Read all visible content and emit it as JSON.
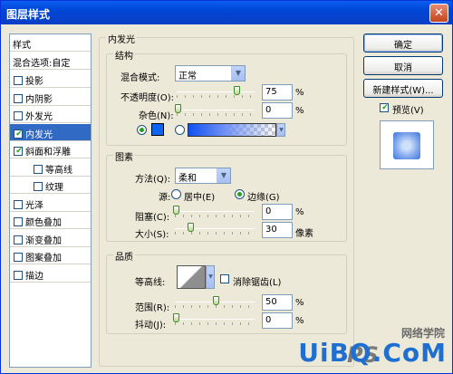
{
  "window": {
    "title": "图层样式"
  },
  "sidebar": {
    "header": "样式",
    "blending": "混合选项:自定",
    "items": [
      {
        "label": "投影",
        "checked": false,
        "selected": false
      },
      {
        "label": "内阴影",
        "checked": false,
        "selected": false
      },
      {
        "label": "外发光",
        "checked": false,
        "selected": false
      },
      {
        "label": "内发光",
        "checked": true,
        "selected": true
      },
      {
        "label": "斜面和浮雕",
        "checked": true,
        "selected": false
      },
      {
        "label": "等高线",
        "checked": false,
        "selected": false,
        "indent": true
      },
      {
        "label": "纹理",
        "checked": false,
        "selected": false,
        "indent": true
      },
      {
        "label": "光泽",
        "checked": false,
        "selected": false
      },
      {
        "label": "颜色叠加",
        "checked": false,
        "selected": false
      },
      {
        "label": "渐变叠加",
        "checked": false,
        "selected": false
      },
      {
        "label": "图案叠加",
        "checked": false,
        "selected": false
      },
      {
        "label": "描边",
        "checked": false,
        "selected": false
      }
    ]
  },
  "panel": {
    "title": "内发光",
    "structure": {
      "label": "结构",
      "blend_mode_label": "混合模式:",
      "blend_mode": "正常",
      "opacity_label": "不透明度(O):",
      "opacity": "75",
      "noise_label": "杂色(N):",
      "noise": "0",
      "unit": "%"
    },
    "elements": {
      "label": "图素",
      "method_label": "方法(Q):",
      "method": "柔和",
      "source_label": "源:",
      "center_label": "居中(E)",
      "edge_label": "边缘(G)",
      "choke_label": "阻塞(C):",
      "choke": "0",
      "size_label": "大小(S):",
      "size": "30",
      "size_unit": "像素",
      "unit": "%"
    },
    "quality": {
      "label": "品质",
      "contour_label": "等高线:",
      "antialias_label": "消除锯齿(L)",
      "range_label": "范围(R):",
      "range": "50",
      "jitter_label": "抖动(J):",
      "jitter": "0",
      "unit": "%"
    }
  },
  "buttons": {
    "ok": "确定",
    "cancel": "取消",
    "new_style": "新建样式(W)...",
    "preview": "预览(V)"
  },
  "watermark": {
    "site": "UiBQ.CoM",
    "cn": "网络学院",
    "ps": "PS"
  },
  "colors": {
    "glow": "#0e64f6",
    "selection": "#316ac5"
  }
}
